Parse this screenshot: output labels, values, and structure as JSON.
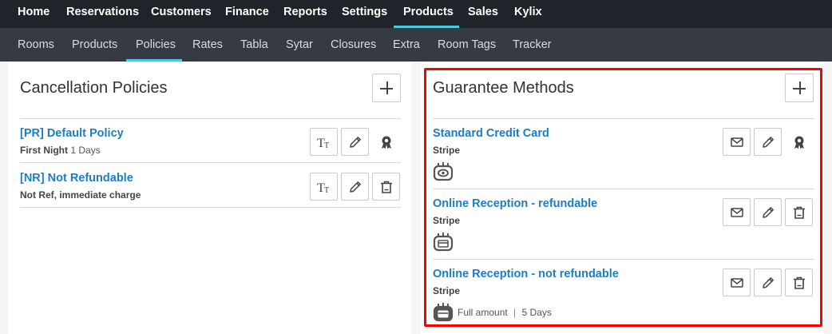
{
  "top_nav": [
    "Home",
    "Reservations",
    "Customers",
    "Finance",
    "Reports",
    "Settings",
    "Products",
    "Sales",
    "Kylix"
  ],
  "sub_nav": [
    "Rooms",
    "Products",
    "Policies",
    "Rates",
    "Tabla",
    "Sytar",
    "Closures",
    "Extra",
    "Room Tags",
    "Tracker"
  ],
  "active_top": "Products",
  "active_sub": "Policies",
  "cancellation": {
    "title": "Cancellation Policies",
    "rows": [
      {
        "title": "[PR] Default Policy",
        "sub_bold": "First Night",
        "sub_light": "1 Days"
      },
      {
        "title": "[NR] Not Refundable",
        "sub_bold": "Not Ref, immediate charge"
      }
    ]
  },
  "guarantee": {
    "title": "Guarantee Methods",
    "rows": [
      {
        "title": "Standard Credit Card",
        "sub": "Stripe"
      },
      {
        "title": "Online Reception - refundable",
        "sub": "Stripe"
      },
      {
        "title": "Online Reception - not refundable",
        "sub": "Stripe",
        "extra_a": "Full amount",
        "extra_sep": "|",
        "extra_b": "5 Days"
      }
    ]
  },
  "icons": {
    "add": "plus-icon",
    "text": "text-size-icon",
    "edit": "pencil-icon",
    "default": "award-icon",
    "delete": "trash-icon",
    "email": "envelope-icon",
    "eye": "card-eye-icon",
    "card": "card-terminal-icon"
  },
  "colors": {
    "accent": "#4ec9df",
    "link": "#1b7ec2",
    "highlight": "#ff0000",
    "topbar": "#1f232a",
    "subbar": "#363b43"
  }
}
